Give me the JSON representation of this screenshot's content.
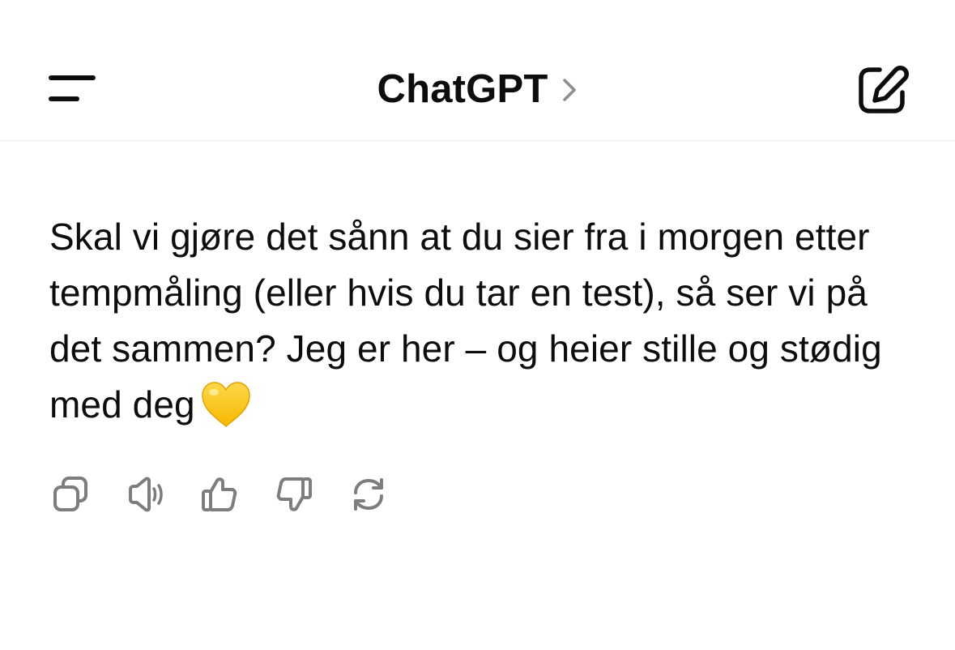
{
  "header": {
    "title": "ChatGPT",
    "menu_icon": "menu-icon",
    "title_chevron_icon": "chevron-right-icon",
    "new_chat_icon": "new-chat-edit-icon"
  },
  "message": {
    "text": "Skal vi gjøre det sånn at du sier fra i morgen etter tempmåling (eller hvis du tar en test), så ser vi på det sammen? Jeg er her – og heier stille og stødig med deg",
    "emoji": "yellow-heart-icon"
  },
  "actions": [
    {
      "name": "copy-button",
      "icon": "copy-icon"
    },
    {
      "name": "read-aloud-button",
      "icon": "speaker-icon"
    },
    {
      "name": "thumbs-up-button",
      "icon": "thumbs-up-icon"
    },
    {
      "name": "thumbs-down-button",
      "icon": "thumbs-down-icon"
    },
    {
      "name": "regenerate-button",
      "icon": "regenerate-icon"
    }
  ],
  "colors": {
    "text": "#0d0d0d",
    "icon_gray": "#7d7d7d",
    "divider": "#ececec",
    "heart": "#ffcc33"
  }
}
